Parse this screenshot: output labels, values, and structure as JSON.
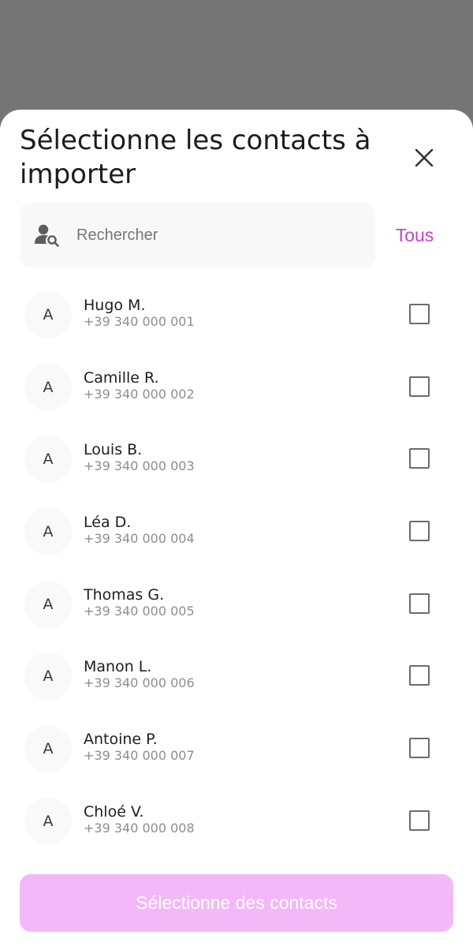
{
  "sheet": {
    "title": "Sélectionne les contacts à importer",
    "close_icon": "close-icon"
  },
  "search": {
    "placeholder": "Rechercher",
    "value": "",
    "icon": "person-search-icon"
  },
  "select_all_label": "Tous",
  "contacts": [
    {
      "initial": "A",
      "name": "Hugo M.",
      "phone": "+39 340 000 001",
      "checked": false
    },
    {
      "initial": "A",
      "name": "Camille R.",
      "phone": "+39 340 000 002",
      "checked": false
    },
    {
      "initial": "A",
      "name": "Louis B.",
      "phone": "+39 340 000 003",
      "checked": false
    },
    {
      "initial": "A",
      "name": "Léa D.",
      "phone": "+39 340 000 004",
      "checked": false
    },
    {
      "initial": "A",
      "name": "Thomas G.",
      "phone": "+39 340 000 005",
      "checked": false
    },
    {
      "initial": "A",
      "name": "Manon L.",
      "phone": "+39 340 000 006",
      "checked": false
    },
    {
      "initial": "A",
      "name": "Antoine P.",
      "phone": "+39 340 000 007",
      "checked": false
    },
    {
      "initial": "A",
      "name": "Chloé V.",
      "phone": "+39 340 000 008",
      "checked": false
    }
  ],
  "confirm_button_label": "Sélectionne des contacts",
  "colors": {
    "accent": "#cb3fcc",
    "button_disabled": "#f3b8f7",
    "overlay": "#757575",
    "search_bg": "#f8f8f8"
  }
}
